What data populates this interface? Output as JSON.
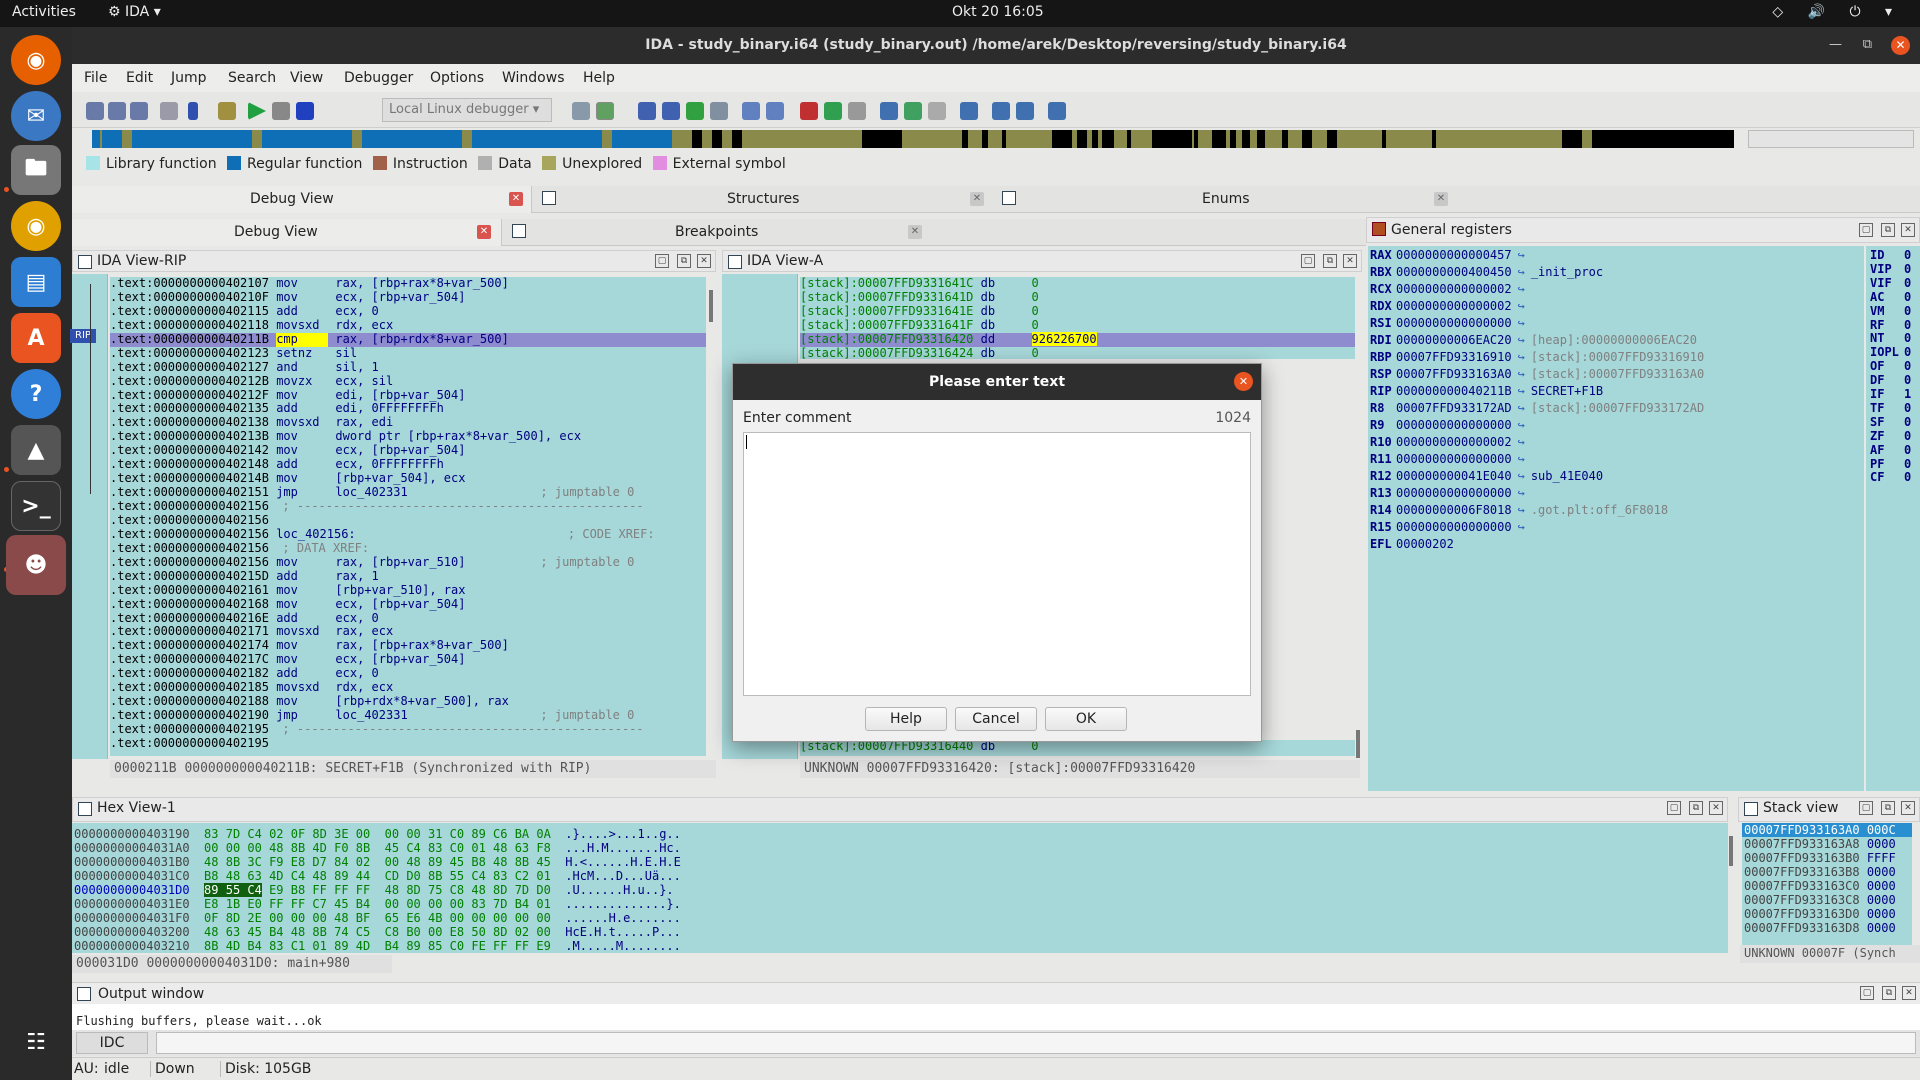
{
  "topbar": {
    "activities": "Activities",
    "app": "IDA",
    "clock": "Okt 20  16:05"
  },
  "window": {
    "title": "IDA - study_binary.i64 (study_binary.out) /home/arek/Desktop/reversing/study_binary.i64"
  },
  "menu": [
    "File",
    "Edit",
    "Jump",
    "Search",
    "View",
    "Debugger",
    "Options",
    "Windows",
    "Help"
  ],
  "toolbar": {
    "debugger_select": "Local Linux debugger"
  },
  "legend": [
    {
      "label": "Library function",
      "color": "#a6e4e8"
    },
    {
      "label": "Regular function",
      "color": "#0f6fb6"
    },
    {
      "label": "Instruction",
      "color": "#a0604a"
    },
    {
      "label": "Data",
      "color": "#b0b0b0"
    },
    {
      "label": "Unexplored",
      "color": "#a8a55c"
    },
    {
      "label": "External symbol",
      "color": "#e28ee0"
    }
  ],
  "tabs_row1": {
    "debug_view": "Debug View",
    "structures": "Structures",
    "enums": "Enums"
  },
  "tabs_row2": {
    "debug_view": "Debug View",
    "breakpoints": "Breakpoints"
  },
  "ida_view_rip": {
    "title": "IDA View-RIP",
    "rip_marker": "RIP",
    "lines": [
      {
        "addr": ".text:0000000000402107",
        "mn": "mov",
        "ops": "rax, [rbp+rax*8+var_500]"
      },
      {
        "addr": ".text:000000000040210F",
        "mn": "mov",
        "ops": "ecx, [rbp+var_504]"
      },
      {
        "addr": ".text:0000000000402115",
        "mn": "add",
        "ops": "ecx, 0"
      },
      {
        "addr": ".text:0000000000402118",
        "mn": "movsxd",
        "ops": "rdx, ecx"
      },
      {
        "addr": ".text:000000000040211B",
        "mn": "cmp",
        "ops": "rax, [rbp+rdx*8+var_500]",
        "current": true
      },
      {
        "addr": ".text:0000000000402123",
        "mn": "setnz",
        "ops": "sil"
      },
      {
        "addr": ".text:0000000000402127",
        "mn": "and",
        "ops": "sil, 1"
      },
      {
        "addr": ".text:000000000040212B",
        "mn": "movzx",
        "ops": "ecx, sil"
      },
      {
        "addr": ".text:000000000040212F",
        "mn": "mov",
        "ops": "edi, [rbp+var_504]"
      },
      {
        "addr": ".text:0000000000402135",
        "mn": "add",
        "ops": "edi, 0FFFFFFFFh"
      },
      {
        "addr": ".text:0000000000402138",
        "mn": "movsxd",
        "ops": "rax, edi"
      },
      {
        "addr": ".text:000000000040213B",
        "mn": "mov",
        "ops": "dword ptr [rbp+rax*8+var_500], ecx"
      },
      {
        "addr": ".text:0000000000402142",
        "mn": "mov",
        "ops": "ecx, [rbp+var_504]"
      },
      {
        "addr": ".text:0000000000402148",
        "mn": "add",
        "ops": "ecx, 0FFFFFFFFh"
      },
      {
        "addr": ".text:000000000040214B",
        "mn": "mov",
        "ops": "[rbp+var_504], ecx"
      },
      {
        "addr": ".text:0000000000402151",
        "mn": "jmp",
        "ops": "loc_402331",
        "cmt": "; jumptable 0"
      },
      {
        "addr": ".text:0000000000402156",
        "mn": "",
        "ops": "",
        "cmt": "; ------------------------------------------------"
      },
      {
        "addr": ".text:0000000000402156",
        "mn": "",
        "ops": ""
      },
      {
        "addr": ".text:0000000000402156",
        "mn": "loc_402156:",
        "ops": "",
        "cmt": "; CODE XREF: "
      },
      {
        "addr": ".text:0000000000402156",
        "mn": "",
        "ops": "",
        "cmt": "; DATA XREF: "
      },
      {
        "addr": ".text:0000000000402156",
        "mn": "mov",
        "ops": "rax, [rbp+var_510]",
        "cmt": "; jumptable 0"
      },
      {
        "addr": ".text:000000000040215D",
        "mn": "add",
        "ops": "rax, 1"
      },
      {
        "addr": ".text:0000000000402161",
        "mn": "mov",
        "ops": "[rbp+var_510], rax"
      },
      {
        "addr": ".text:0000000000402168",
        "mn": "mov",
        "ops": "ecx, [rbp+var_504]"
      },
      {
        "addr": ".text:000000000040216E",
        "mn": "add",
        "ops": "ecx, 0"
      },
      {
        "addr": ".text:0000000000402171",
        "mn": "movsxd",
        "ops": "rax, ecx"
      },
      {
        "addr": ".text:0000000000402174",
        "mn": "mov",
        "ops": "rax, [rbp+rax*8+var_500]"
      },
      {
        "addr": ".text:000000000040217C",
        "mn": "mov",
        "ops": "ecx, [rbp+var_504]"
      },
      {
        "addr": ".text:0000000000402182",
        "mn": "add",
        "ops": "ecx, 0"
      },
      {
        "addr": ".text:0000000000402185",
        "mn": "movsxd",
        "ops": "rdx, ecx"
      },
      {
        "addr": ".text:0000000000402188",
        "mn": "mov",
        "ops": "[rbp+rdx*8+var_500], rax"
      },
      {
        "addr": ".text:0000000000402190",
        "mn": "jmp",
        "ops": "loc_402331",
        "cmt": "; jumptable 0"
      },
      {
        "addr": ".text:0000000000402195",
        "mn": "",
        "ops": "",
        "cmt": "; ------------------------------------------------"
      },
      {
        "addr": ".text:0000000000402195",
        "mn": "",
        "ops": ""
      }
    ],
    "status": "0000211B 000000000040211B: SECRET+F1B (Synchronized with RIP)"
  },
  "ida_view_a": {
    "title": "IDA View-A",
    "lines": [
      {
        "addr": "[stack]:00007FFD9331641C",
        "mn": "db",
        "ops": "0"
      },
      {
        "addr": "[stack]:00007FFD9331641D",
        "mn": "db",
        "ops": "0"
      },
      {
        "addr": "[stack]:00007FFD9331641E",
        "mn": "db",
        "ops": "0"
      },
      {
        "addr": "[stack]:00007FFD9331641F",
        "mn": "db",
        "ops": "0"
      },
      {
        "addr": "[stack]:00007FFD93316420",
        "mn": "dd",
        "ops": "926226700",
        "current": true
      },
      {
        "addr": "[stack]:00007FFD93316424",
        "mn": "db",
        "ops": "0"
      }
    ],
    "last_line": {
      "addr": "[stack]:00007FFD93316440",
      "mn": "db",
      "ops": "0"
    },
    "status": "UNKNOWN 00007FFD93316420: [stack]:00007FFD93316420"
  },
  "registers": {
    "title": "General registers",
    "rows": [
      {
        "name": "RAX",
        "value": "0000000000000457",
        "desc": ""
      },
      {
        "name": "RBX",
        "value": "0000000000400450",
        "desc": "_init_proc"
      },
      {
        "name": "RCX",
        "value": "0000000000000002",
        "desc": ""
      },
      {
        "name": "RDX",
        "value": "0000000000000002",
        "desc": ""
      },
      {
        "name": "RSI",
        "value": "0000000000000000",
        "desc": ""
      },
      {
        "name": "RDI",
        "value": "00000000006EAC20",
        "desc": "[heap]:00000000006EAC20"
      },
      {
        "name": "RBP",
        "value": "00007FFD93316910",
        "desc": "[stack]:00007FFD93316910"
      },
      {
        "name": "RSP",
        "value": "00007FFD933163A0",
        "desc": "[stack]:00007FFD933163A0"
      },
      {
        "name": "RIP",
        "value": "000000000040211B",
        "desc": "SECRET+F1B"
      },
      {
        "name": "R8",
        "value": "00007FFD933172AD",
        "desc": "[stack]:00007FFD933172AD"
      },
      {
        "name": "R9",
        "value": "0000000000000000",
        "desc": ""
      },
      {
        "name": "R10",
        "value": "0000000000000002",
        "desc": ""
      },
      {
        "name": "R11",
        "value": "0000000000000000",
        "desc": ""
      },
      {
        "name": "R12",
        "value": "000000000041E040",
        "desc": "sub_41E040"
      },
      {
        "name": "R13",
        "value": "0000000000000000",
        "desc": ""
      },
      {
        "name": "R14",
        "value": "00000000006F8018",
        "desc": ".got.plt:off_6F8018"
      },
      {
        "name": "R15",
        "value": "0000000000000000",
        "desc": ""
      },
      {
        "name": "EFL",
        "value": "00000202",
        "desc": ""
      }
    ],
    "flags": [
      {
        "name": "ID",
        "value": "0"
      },
      {
        "name": "VIP",
        "value": "0"
      },
      {
        "name": "VIF",
        "value": "0"
      },
      {
        "name": "AC",
        "value": "0"
      },
      {
        "name": "VM",
        "value": "0"
      },
      {
        "name": "RF",
        "value": "0"
      },
      {
        "name": "NT",
        "value": "0"
      },
      {
        "name": "IOPL",
        "value": "0"
      },
      {
        "name": "OF",
        "value": "0"
      },
      {
        "name": "DF",
        "value": "0"
      },
      {
        "name": "IF",
        "value": "1"
      },
      {
        "name": "TF",
        "value": "0"
      },
      {
        "name": "SF",
        "value": "0"
      },
      {
        "name": "ZF",
        "value": "0"
      },
      {
        "name": "AF",
        "value": "0"
      },
      {
        "name": "PF",
        "value": "0"
      },
      {
        "name": "CF",
        "value": "0"
      }
    ]
  },
  "hex_view": {
    "title": "Hex View-1",
    "rows": [
      {
        "addr": "0000000000403190",
        "bytes": "83 7D C4 02 0F 8D 3E 00  00 00 31 C0 89 C6 BA 0A",
        "ascii": ".}....>...1..g.."
      },
      {
        "addr": "00000000004031A0",
        "bytes": "00 00 00 48 8B 4D F0 8B  45 C4 83 C0 01 48 63 F8",
        "ascii": "...H.M.......Hc."
      },
      {
        "addr": "00000000004031B0",
        "bytes": "48 8B 3C F9 E8 D7 84 02  00 48 89 45 B8 48 8B 45",
        "ascii": "H.<......H.E.H.E"
      },
      {
        "addr": "00000000004031C0",
        "bytes": "B8 48 63 4D C4 48 89 44  CD D0 8B 55 C4 83 C2 01",
        "ascii": ".HcM...D...Uä..."
      },
      {
        "addr": "00000000004031D0",
        "bytes": "89 55 C4 E9 B8 FF FF FF  48 8D 75 C8 48 8D 7D D0",
        "ascii": ".U......H.u..}.",
        "current": true,
        "sel": "89 55 C4"
      },
      {
        "addr": "00000000004031E0",
        "bytes": "E8 1B E0 FF FF C7 45 B4  00 00 00 00 83 7D B4 01",
        "ascii": "..............}."
      },
      {
        "addr": "00000000004031F0",
        "bytes": "0F 8D 2E 00 00 00 48 BF  65 E6 4B 00 00 00 00 00",
        "ascii": "......H.e......."
      },
      {
        "addr": "0000000000403200",
        "bytes": "48 63 45 B4 48 8B 74 C5  C8 B0 00 E8 50 8D 02 00",
        "ascii": "HcE.H.t.....P..."
      },
      {
        "addr": "0000000000403210",
        "bytes": "8B 4D B4 83 C1 01 89 4D  B4 89 85 C0 FE FF FF E9",
        "ascii": ".M.....M........"
      }
    ],
    "status": "000031D0 00000000004031D0: main+980"
  },
  "stack_view": {
    "title": "Stack view",
    "rows": [
      {
        "addr": "00007FFD933163A0",
        "val": "000C"
      },
      {
        "addr": "00007FFD933163A8",
        "val": "0000"
      },
      {
        "addr": "00007FFD933163B0",
        "val": "FFFF"
      },
      {
        "addr": "00007FFD933163B8",
        "val": "0000"
      },
      {
        "addr": "00007FFD933163C0",
        "val": "0000"
      },
      {
        "addr": "00007FFD933163C8",
        "val": "0000"
      },
      {
        "addr": "00007FFD933163D0",
        "val": "0000"
      },
      {
        "addr": "00007FFD933163D8",
        "val": "0000"
      }
    ],
    "status": "UNKNOWN 00007F (Synch"
  },
  "output": {
    "title": "Output window",
    "line1": "Flushing buffers, please wait...ok"
  },
  "idc": {
    "button": "IDC"
  },
  "statusbar": {
    "au": "AU:",
    "au_state": "idle",
    "direction": "Down",
    "disk": "Disk: 105GB"
  },
  "dialog": {
    "title": "Please enter text",
    "label": "Enter comment",
    "count": "1024",
    "value": "",
    "help": "Help",
    "cancel": "Cancel",
    "ok": "OK"
  }
}
